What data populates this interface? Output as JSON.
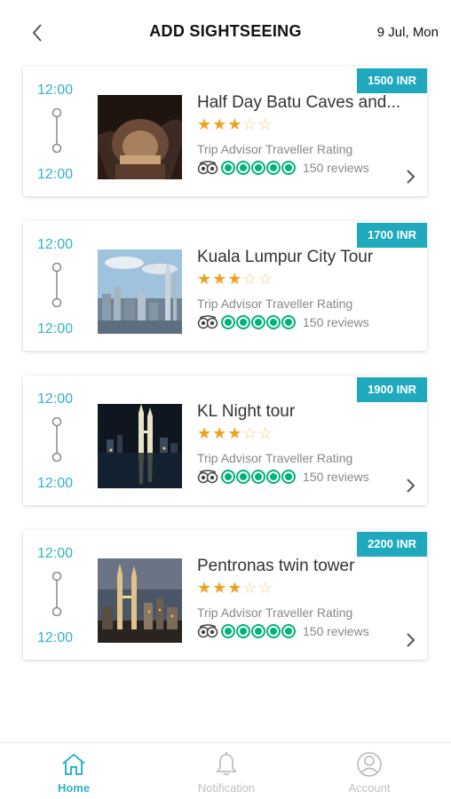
{
  "header": {
    "title": "ADD SIGHTSEEING",
    "date": "9 Jul, Mon"
  },
  "cards": [
    {
      "price": "1500 INR",
      "start_time": "12:00",
      "end_time": "12:00",
      "title": "Half Day Batu Caves and...",
      "stars": 3,
      "max_stars": 5,
      "rating_label": "Trip Advisor Traveller Rating",
      "bubbles": 5,
      "reviews": "150 reviews",
      "has_arrow": true,
      "image": "batu-caves-image"
    },
    {
      "price": "1700 INR",
      "start_time": "12:00",
      "end_time": "12:00",
      "title": "Kuala Lumpur City Tour",
      "stars": 3,
      "max_stars": 5,
      "rating_label": "Trip Advisor Traveller Rating",
      "bubbles": 5,
      "reviews": "150 reviews",
      "has_arrow": false,
      "image": "kuala-lumpur-skyline-image"
    },
    {
      "price": "1900 INR",
      "start_time": "12:00",
      "end_time": "12:00",
      "title": "KL Night tour",
      "stars": 3,
      "max_stars": 5,
      "rating_label": "Trip Advisor Traveller Rating",
      "bubbles": 5,
      "reviews": "150 reviews",
      "has_arrow": true,
      "image": "kl-night-image"
    },
    {
      "price": "2200 INR",
      "start_time": "12:00",
      "end_time": "12:00",
      "title": "Pentronas twin tower",
      "stars": 3,
      "max_stars": 5,
      "rating_label": "Trip Advisor Traveller Rating",
      "bubbles": 5,
      "reviews": "150 reviews",
      "has_arrow": true,
      "image": "petronas-towers-image"
    }
  ],
  "bottom_nav": [
    {
      "label": "Home",
      "icon": "home-icon",
      "active": true
    },
    {
      "label": "Notification",
      "icon": "bell-icon",
      "active": false
    },
    {
      "label": "Account",
      "icon": "account-icon",
      "active": false
    }
  ],
  "colors": {
    "accent": "#2eb4c6",
    "price_badge": "#20a9bd",
    "star": "#f0a020",
    "tripadvisor_green": "#00b27a",
    "inactive_nav": "#c0c0c0"
  }
}
